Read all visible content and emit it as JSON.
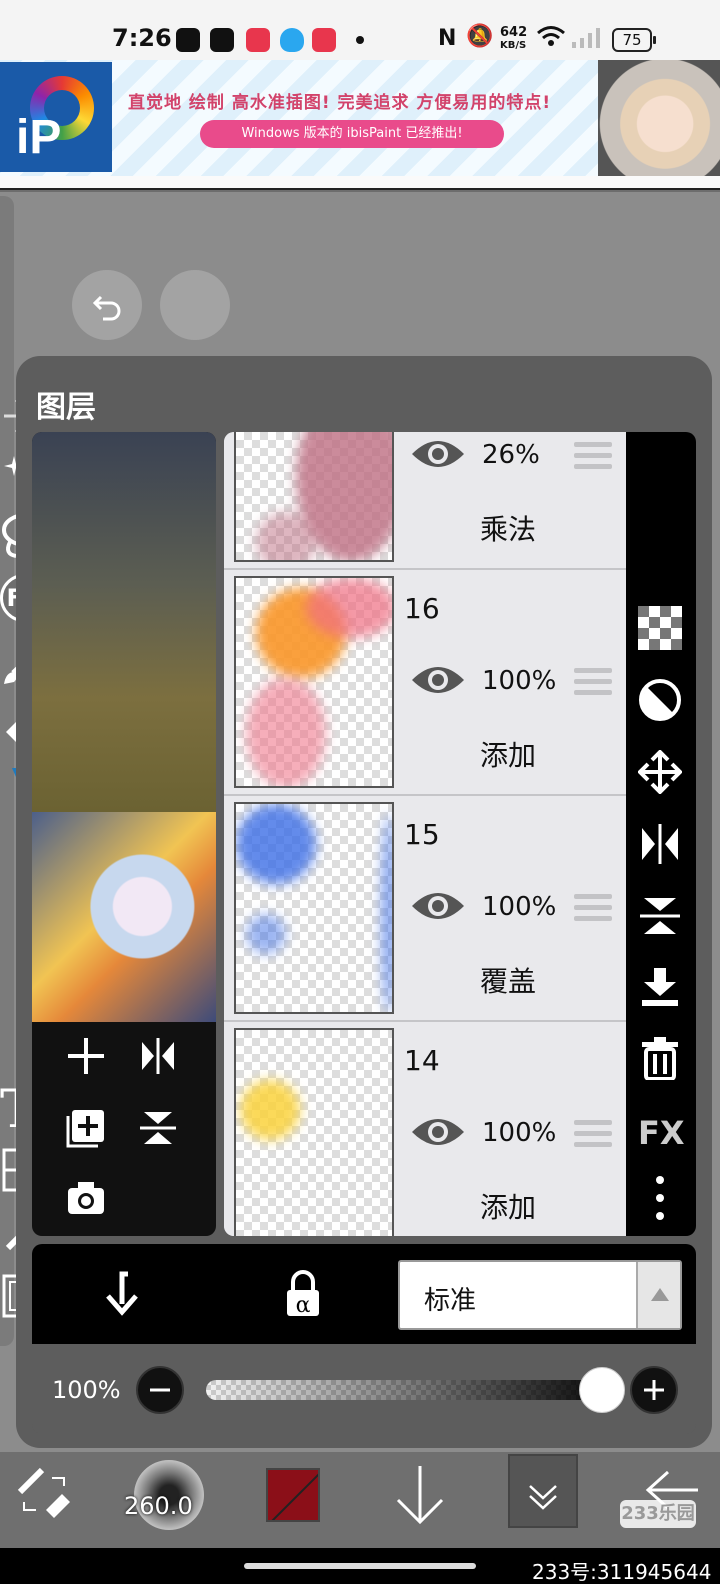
{
  "status_bar": {
    "time": "7:26",
    "net_speed": "642",
    "net_unit": "KB/S",
    "battery": "75"
  },
  "banner": {
    "headline": "直觉地 绘制 高水准插图! 完美追求 方便易用的特点!",
    "subline": "Windows 版本的 ibisPaint 已经推出!",
    "logo_text": "iP"
  },
  "layer_panel": {
    "title": "图层",
    "layers": [
      {
        "name": "",
        "opacity": "26%",
        "blend": "乘法"
      },
      {
        "name": "16",
        "opacity": "100%",
        "blend": "添加"
      },
      {
        "name": "15",
        "opacity": "100%",
        "blend": "覆盖"
      },
      {
        "name": "14",
        "opacity": "100%",
        "blend": "添加"
      }
    ],
    "blend_mode": "标准",
    "opacity_label": "100%",
    "opacity_value": 1.0,
    "right_tools": [
      "checker-icon",
      "circle-slash-icon",
      "move-icon",
      "flip-horizontal-icon",
      "flip-vertical-icon",
      "merge-down-icon",
      "trash-icon",
      "fx-icon",
      "more-icon"
    ],
    "fx_label": "FX"
  },
  "toolbar": {
    "fx_label": "FX",
    "brush_size": "260.0"
  },
  "watermark": {
    "id_text": "233号:311945644",
    "logo": "233乐园"
  },
  "colors": {
    "primary_color": "#8b0f18",
    "panel_bg": "#5d5d5d"
  }
}
